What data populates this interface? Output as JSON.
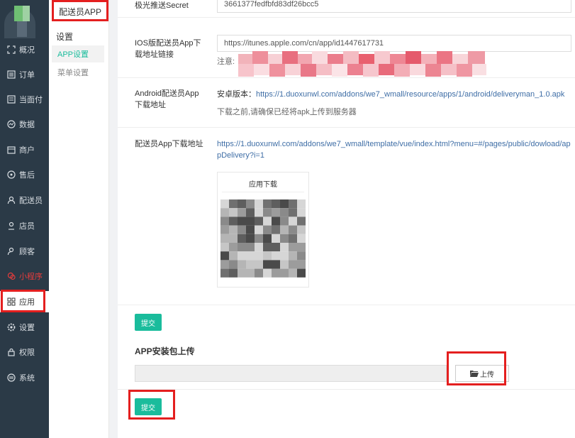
{
  "submenu": {
    "title": "配送员APP",
    "group": "设置",
    "items": [
      "APP设置",
      "菜单设置"
    ]
  },
  "nav": {
    "items": [
      {
        "label": "概况",
        "icon": "overview-icon"
      },
      {
        "label": "订单",
        "icon": "order-icon"
      },
      {
        "label": "当面付",
        "icon": "face-pay-icon"
      },
      {
        "label": "数据",
        "icon": "data-icon"
      },
      {
        "label": "商户",
        "icon": "store-icon"
      },
      {
        "label": "售后",
        "icon": "after-sale-icon"
      },
      {
        "label": "配送员",
        "icon": "delivery-person-icon"
      },
      {
        "label": "店员",
        "icon": "clerk-icon"
      },
      {
        "label": "顾客",
        "icon": "customer-icon"
      },
      {
        "label": "小程序",
        "icon": "wechat-miniprogram-icon"
      },
      {
        "label": "应用",
        "icon": "apps-grid-icon"
      },
      {
        "label": "设置",
        "icon": "gear-icon"
      },
      {
        "label": "权限",
        "icon": "lock-icon"
      },
      {
        "label": "系统",
        "icon": "system-icon"
      }
    ],
    "active": "应用"
  },
  "form": {
    "secret": {
      "label": "极光推送Secret",
      "value": "3661377fedfbfd83df26bcc5"
    },
    "ios": {
      "label": "IOS版配送员App下载地址链接",
      "value": "https://itunes.apple.com/cn/app/id1447617731",
      "note": "注意:"
    },
    "android": {
      "label": "Android配送员App下载地址",
      "prefix": "安卓版本：",
      "link": "https://1.duoxunwl.com/addons/we7_wmall/resource/apps/1/android/deliveryman_1.0.apk",
      "note": "下载之前,请确保已经将apk上传到服务器"
    },
    "download": {
      "label": "配送员App下载地址",
      "link": "https://1.duoxunwl.com/addons/we7_wmall/template/vue/index.html?menu=#/pages/public/dowload/appDelivery?i=1",
      "qr_title": "应用下载"
    },
    "submit": "提交"
  },
  "upload": {
    "title": "APP安装包上传",
    "button": "上传",
    "submit": "提交"
  },
  "colors": {
    "accent": "#1abc9c",
    "sidebar": "#2b3a47",
    "highlight": "#e41f1f",
    "link": "#3f6ea6"
  }
}
